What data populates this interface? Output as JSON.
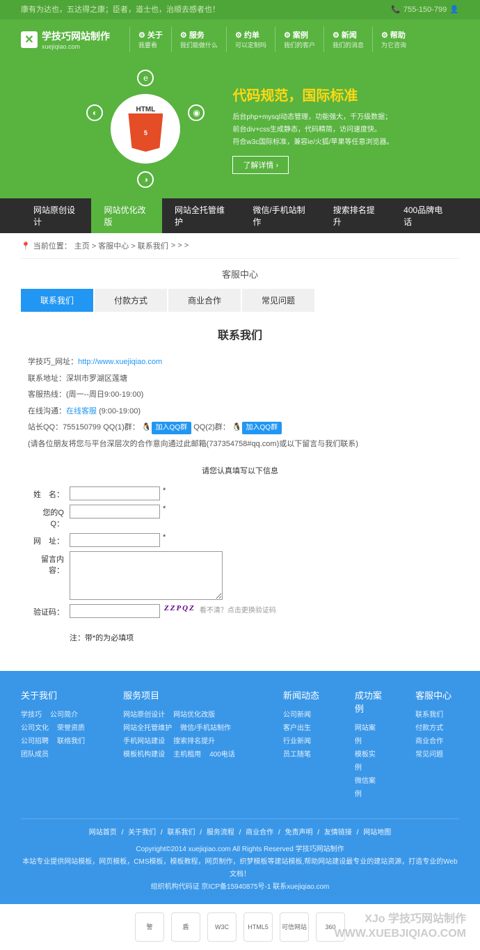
{
  "topbar": {
    "quote": "康有为达也，五达得之康；臣者，道士也，治顺去感者也！",
    "phone": "755-150-799"
  },
  "logo": {
    "name": "学技巧网站制作",
    "sub": "xuejiqiao.com"
  },
  "nav": [
    {
      "t": "关于",
      "s": "我要看"
    },
    {
      "t": "服务",
      "s": "我们能做什么"
    },
    {
      "t": "约单",
      "s": "可以定制吗"
    },
    {
      "t": "案例",
      "s": "我们的客户"
    },
    {
      "t": "新闻",
      "s": "我们的消息"
    },
    {
      "t": "帮助",
      "s": "为它咨询"
    }
  ],
  "hero": {
    "title": "代码规范，国际标准",
    "line1": "后台php+mysql动态管理，功能强大，千万级数据；",
    "line2": "前台div+css生成静态，代码精简，访问速度快。",
    "line3": "符合w3c国际标准，兼容ie/火狐/苹果等任意浏览器。",
    "btn": "了解详情 ›",
    "badge_label": "HTML"
  },
  "subnav": [
    "网站原创设计",
    "网站优化改版",
    "网站全托管维护",
    "微信/手机站制作",
    "搜索排名提升",
    "400品牌电话"
  ],
  "subnav_active": 1,
  "breadcrumb": {
    "prefix": "当前位置：",
    "parts": [
      "主页",
      "客服中心",
      "联系我们"
    ],
    "suffix": " > > >"
  },
  "section_title": "客服中心",
  "tabs": [
    "联系我们",
    "付款方式",
    "商业合作",
    "常见问题"
  ],
  "tabs_active": 0,
  "page_title": "联系我们",
  "info": {
    "site_label": "学技巧_网址：",
    "site_url": "http://www.xuejiqiao.com",
    "address": "联系地址：深圳市罗湖区莲塘",
    "hotline": "客服热线：(周一--周日9:00-19:00)",
    "online_label": "在线沟通：",
    "online_link": "在线客服",
    "online_time": "(9:00-19:00)",
    "qq_prefix": "站长QQ：755150799 QQ(1)群：",
    "qq_btn": "加入QQ群",
    "qq_mid": " QQ(2)群：",
    "note": "(请各位朋友将您与平台深层次的合作意向通过此邮箱(737354758#qq.com)或以下留言与我们联系)"
  },
  "form": {
    "title": "请您认真填写以下信息",
    "name_label": "姓　名：",
    "qq_label": "您的Q Q：",
    "url_label": "网　址：",
    "msg_label": "留言内容：",
    "captcha_label": "验证码：",
    "captcha_text": "ZZPQZ",
    "captcha_hint": "看不清？点击更换验证码",
    "note": "注：带*的为必填项"
  },
  "footer": {
    "cols": [
      {
        "title": "关于我们",
        "items": [
          "学技巧",
          "公司简介",
          "公司文化",
          "荣誉资质",
          "公司招聘",
          "联络我们",
          "团队成员"
        ]
      },
      {
        "title": "服务项目",
        "items": [
          "网站原创设计",
          "网站优化改版",
          "网站全托管维护",
          "微信/手机站制作",
          "手机网站建设",
          "搜索排名提升",
          "模板机构建设",
          "主机租用",
          "400电话"
        ]
      },
      {
        "title": "新闻动态",
        "items": [
          "公司新闻",
          "客户出生",
          "行业新闻",
          "员工随笔"
        ]
      },
      {
        "title": "成功案例",
        "items": [
          "网站案例",
          "模板实例",
          "微信案例"
        ]
      },
      {
        "title": "客服中心",
        "items": [
          "联系我们",
          "付款方式",
          "商业合作",
          "常见问题"
        ]
      }
    ],
    "links": [
      "网站首页",
      "关于我们",
      "联系我们",
      "服务流程",
      "商业合作",
      "免责声明",
      "友情链接",
      "网站地图"
    ],
    "copy1": "Copyright©2014  xuejiqiao.com All Rights Reserved  学技巧网站制作",
    "copy2": "本站专业提供网站模板，网页模板，CMS模板，模板教程，网页制作，织梦模板等建站模板,帮助网站建设最专业的建站资源，打造专业的Web文档！",
    "copy3": "组织机构代码证  京ICP备15940875号-1  联系xuejiqiao.com"
  },
  "watermark": {
    "line1": "XJo 学技巧网站制作",
    "line2": "WWW.XUEBJIQIAO.COM"
  },
  "badges": [
    "警",
    "盾",
    "W3C",
    "HTML5",
    "可信网站",
    "360"
  ]
}
